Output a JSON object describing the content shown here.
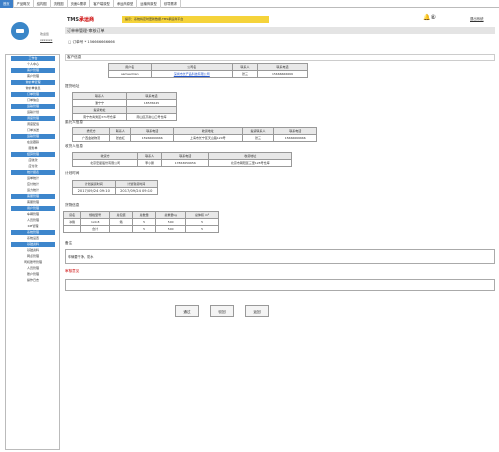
{
  "topnav": [
    "首页",
    "产品概况",
    "结构图",
    "流程图",
    "页面&需求",
    "客户端原型",
    "承运商原型",
    "运输商原型",
    "领导需求"
  ],
  "brand": {
    "prefix": "TMS",
    "suffix": "承运商"
  },
  "notice": "提示：系统将定时更新数据,TMS承运商平台",
  "alarm_count": "⑧",
  "logout": "退出系统",
  "user": {
    "welcome": "欢迎您",
    "name": "xxxxxxx"
  },
  "sidebar": [
    {
      "group": "工作台",
      "items": [
        "个人中心"
      ]
    },
    {
      "group": "客户管理",
      "items": [
        "客户管理"
      ]
    },
    {
      "group": "询价单管理",
      "items": [
        "询价单信息"
      ]
    },
    {
      "group": "订单管理",
      "items": [
        "订单信息"
      ]
    },
    {
      "group": "运输管理",
      "items": [
        "运输计划"
      ]
    },
    {
      "group": "调度管理",
      "items": [
        "调度配载",
        "订单派送"
      ]
    },
    {
      "group": "运输管理",
      "items": [
        "在途跟踪",
        "服务单"
      ]
    },
    {
      "group": "结算管理",
      "items": [
        "应收款",
        "应付款"
      ]
    },
    {
      "group": "统计报表",
      "items": [
        "运单统计",
        "应付统计",
        "运力统计"
      ]
    },
    {
      "group": "客服管理",
      "items": [
        "客服管理"
      ]
    },
    {
      "group": "用户管理",
      "items": [
        "车辆管理",
        "人员管理",
        "KPI管理"
      ]
    },
    {
      "group": "系统管理",
      "items": [
        "系统设置"
      ]
    },
    {
      "group": "基础资料",
      "items": [
        "基础资料",
        "网点管理",
        "司机账号管理",
        "人员管理",
        "账户管理",
        "操作日志"
      ]
    }
  ],
  "page_title": "订单单管理-审核订单",
  "order_no": "订单号 * 156666666666",
  "customer": {
    "title": "客户信息",
    "headers": [
      "用户名",
      "公司名",
      "联系人",
      "联系电话"
    ],
    "row": [
      "samsedrian",
      "深圳市长产品科技有限公司",
      "张三",
      "15666666666"
    ]
  },
  "pickup": {
    "title": "提货地址",
    "headers": [
      "联系人",
      "联系电话",
      "提货地址"
    ],
    "row": [
      "潘宁宁",
      "18535645",
      "南宁市青秀区371号仓库",
      "南山区高新山口号仓库"
    ]
  },
  "shipper": {
    "title": "委托人信息",
    "headers": [
      "委托方",
      "联系人",
      "联系电话",
      "收货地址",
      "提货联系人",
      "联系电话"
    ],
    "row": [
      "广西金航物流",
      "张启红",
      "15966666666",
      "上海市长宁区天山路120号",
      "张三",
      "15666666666"
    ]
  },
  "receiver": {
    "title": "收货人信息",
    "headers": [
      "收货方",
      "联系人",
      "联系电话",
      "收货地址"
    ],
    "row": [
      "北京宏星股份有限公司",
      "李小鹏",
      "17863656656",
      "北京市朝阳区三里128号仓库"
    ]
  },
  "plan": {
    "title": "计划时间",
    "headers": [
      "计划提货时间",
      "计划到货时间"
    ],
    "row": [
      "2017/09/24 09:10",
      "2017/09/24 09:10"
    ]
  },
  "goods": {
    "title": "货物信息",
    "headers": [
      "货名",
      "规格型号",
      "总包装",
      "总数量",
      "总重量kg",
      "总体积 m³"
    ],
    "rows": [
      [
        "冰箱",
        "1x0.8",
        "箱",
        "5",
        "500",
        "5"
      ],
      [
        "",
        "合计",
        "",
        "5",
        "500",
        "5"
      ]
    ]
  },
  "remark": {
    "title": "备注",
    "text": "车辆要干净，防水"
  },
  "audit": {
    "title": "审核意见"
  },
  "buttons": {
    "pass": "通过",
    "reject": "驳回",
    "back": "返回"
  }
}
